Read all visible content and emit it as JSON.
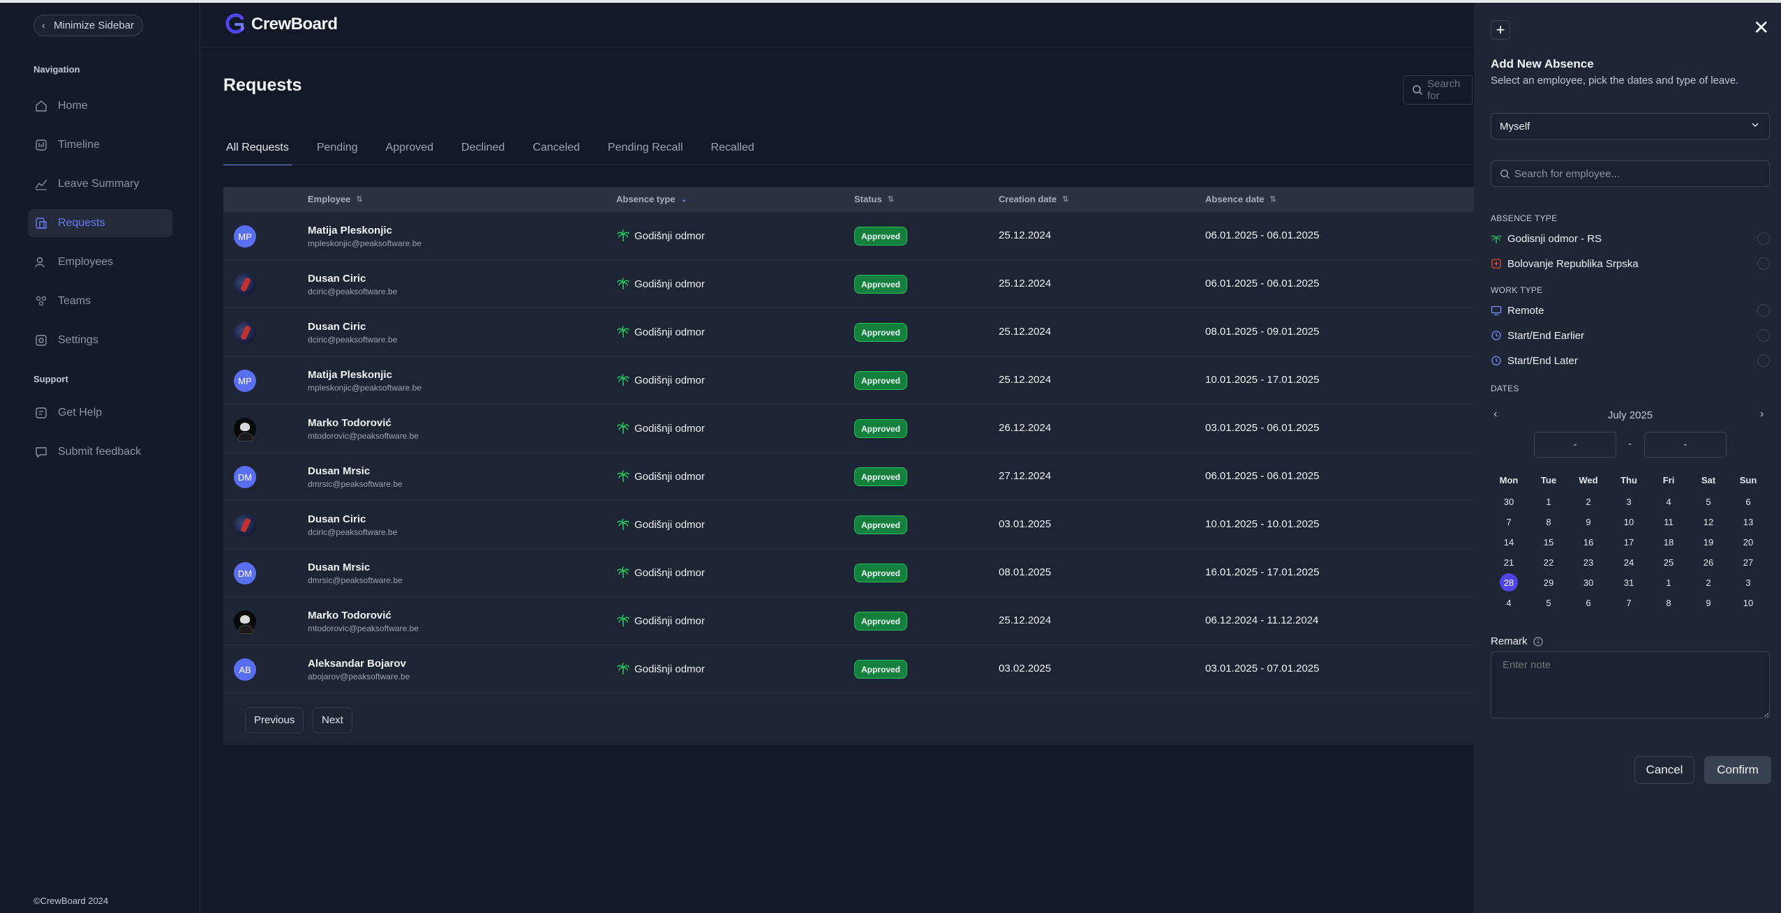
{
  "sidebar": {
    "minimize_label": "Minimize Sidebar",
    "nav_title": "Navigation",
    "items": [
      {
        "label": "Home",
        "icon": "home-icon"
      },
      {
        "label": "Timeline",
        "icon": "timeline-icon"
      },
      {
        "label": "Leave Summary",
        "icon": "chart-line-icon"
      },
      {
        "label": "Requests",
        "icon": "requests-icon"
      },
      {
        "label": "Employees",
        "icon": "users-icon"
      },
      {
        "label": "Teams",
        "icon": "teams-icon"
      },
      {
        "label": "Settings",
        "icon": "settings-icon"
      }
    ],
    "support_title": "Support",
    "support_items": [
      {
        "label": "Get Help",
        "icon": "help-icon"
      },
      {
        "label": "Submit feedback",
        "icon": "feedback-icon"
      }
    ],
    "copyright": "©CrewBoard 2024"
  },
  "header": {
    "brand": "CrewBoard"
  },
  "main": {
    "title": "Requests",
    "search_placeholder": "Search for",
    "tabs": [
      "All Requests",
      "Pending",
      "Approved",
      "Declined",
      "Canceled",
      "Pending Recall",
      "Recalled"
    ],
    "columns": {
      "employee": "Employee",
      "absence_type": "Absence type",
      "status": "Status",
      "creation_date": "Creation date",
      "absence_date": "Absence date"
    },
    "rows": [
      {
        "initials": "MP",
        "avatar": "initials",
        "name": "Matija Pleskonjic",
        "email": "mpleskonjic@peaksoftware.be",
        "type": "Godišnji odmor",
        "status": "Approved",
        "created": "25.12.2024",
        "dates": "06.01.2025 - 06.01.2025"
      },
      {
        "initials": "",
        "avatar": "photo",
        "name": "Dusan Ciric",
        "email": "dciric@peaksoftware.be",
        "type": "Godišnji odmor",
        "status": "Approved",
        "created": "25.12.2024",
        "dates": "06.01.2025 - 06.01.2025"
      },
      {
        "initials": "",
        "avatar": "photo",
        "name": "Dusan Ciric",
        "email": "dciric@peaksoftware.be",
        "type": "Godišnji odmor",
        "status": "Approved",
        "created": "25.12.2024",
        "dates": "08.01.2025 - 09.01.2025"
      },
      {
        "initials": "MP",
        "avatar": "initials",
        "name": "Matija Pleskonjic",
        "email": "mpleskonjic@peaksoftware.be",
        "type": "Godišnji odmor",
        "status": "Approved",
        "created": "25.12.2024",
        "dates": "10.01.2025 - 17.01.2025"
      },
      {
        "initials": "",
        "avatar": "dark",
        "name": "Marko Todorović",
        "email": "mtodorovic@peaksoftware.be",
        "type": "Godišnji odmor",
        "status": "Approved",
        "created": "26.12.2024",
        "dates": "03.01.2025 - 06.01.2025"
      },
      {
        "initials": "DM",
        "avatar": "initials",
        "name": "Dusan Mrsic",
        "email": "dmrsic@peaksoftware.be",
        "type": "Godišnji odmor",
        "status": "Approved",
        "created": "27.12.2024",
        "dates": "06.01.2025 - 06.01.2025"
      },
      {
        "initials": "",
        "avatar": "photo",
        "name": "Dusan Ciric",
        "email": "dciric@peaksoftware.be",
        "type": "Godišnji odmor",
        "status": "Approved",
        "created": "03.01.2025",
        "dates": "10.01.2025 - 10.01.2025"
      },
      {
        "initials": "DM",
        "avatar": "initials",
        "name": "Dusan Mrsic",
        "email": "dmrsic@peaksoftware.be",
        "type": "Godišnji odmor",
        "status": "Approved",
        "created": "08.01.2025",
        "dates": "16.01.2025 - 17.01.2025"
      },
      {
        "initials": "",
        "avatar": "dark",
        "name": "Marko Todorović",
        "email": "mtodorovic@peaksoftware.be",
        "type": "Godišnji odmor",
        "status": "Approved",
        "created": "25.12.2024",
        "dates": "06.12.2024 - 11.12.2024"
      },
      {
        "initials": "AB",
        "avatar": "initials",
        "name": "Aleksandar Bojarov",
        "email": "abojarov@peaksoftware.be",
        "type": "Godišnji odmor",
        "status": "Approved",
        "created": "03.02.2025",
        "dates": "03.01.2025 - 07.01.2025"
      }
    ],
    "pagination": {
      "previous": "Previous",
      "next": "Next"
    }
  },
  "panel": {
    "title": "Add New Absence",
    "subtitle": "Select an employee, pick the dates and type of leave.",
    "employee_select": "Myself",
    "employee_search_placeholder": "Search for employee...",
    "absence_type_label": "ABSENCE TYPE",
    "absence_types": [
      {
        "label": "Godisnji odmor - RS",
        "icon": "palm-tree-icon"
      },
      {
        "label": "Bolovanje Republika Srpska",
        "icon": "medical-icon"
      }
    ],
    "work_type_label": "WORK TYPE",
    "work_types": [
      {
        "label": "Remote",
        "icon": "monitor-icon"
      },
      {
        "label": "Start/End Earlier",
        "icon": "clock-icon"
      },
      {
        "label": "Start/End Later",
        "icon": "clock-icon"
      }
    ],
    "dates_label": "DATES",
    "calendar": {
      "month": "July 2025",
      "start": "-",
      "separator": "-",
      "end": "-",
      "weekdays": [
        "Mon",
        "Tue",
        "Wed",
        "Thu",
        "Fri",
        "Sat",
        "Sun"
      ],
      "weeks": [
        [
          "30",
          "1",
          "2",
          "3",
          "4",
          "5",
          "6"
        ],
        [
          "7",
          "8",
          "9",
          "10",
          "11",
          "12",
          "13"
        ],
        [
          "14",
          "15",
          "16",
          "17",
          "18",
          "19",
          "20"
        ],
        [
          "21",
          "22",
          "23",
          "24",
          "25",
          "26",
          "27"
        ],
        [
          "28",
          "29",
          "30",
          "31",
          "1",
          "2",
          "3"
        ],
        [
          "4",
          "5",
          "6",
          "7",
          "8",
          "9",
          "10"
        ]
      ],
      "selected": "28"
    },
    "remark_label": "Remark",
    "remark_placeholder": "Enter note",
    "cancel_label": "Cancel",
    "confirm_label": "Confirm"
  },
  "colors": {
    "accent": "#6b7cf5",
    "approved_bg": "#15803d",
    "approved_border": "#22c55e",
    "palm_green": "#22c55e",
    "medical_red": "#ef4444",
    "monitor_blue": "#818cf8"
  }
}
